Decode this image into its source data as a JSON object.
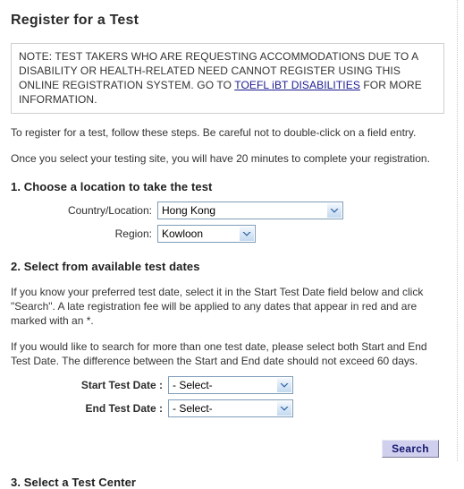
{
  "page": {
    "title": "Register for a Test"
  },
  "note": {
    "text_before_link": "NOTE: TEST TAKERS WHO ARE REQUESTING ACCOMMODATIONS DUE TO A DISABILITY OR HEALTH-RELATED NEED CANNOT REGISTER USING THIS ONLINE REGISTRATION SYSTEM. GO TO ",
    "link_label": "TOEFL iBT DISABILITIES",
    "text_after_link": " FOR MORE INFORMATION.",
    "link_color": "#1b1b8f",
    "border_color": "#cfcfcf"
  },
  "intro": {
    "paragraph_1": "To register for a test, follow these steps. Be careful not to double-click on a field entry.",
    "paragraph_2": "Once you select your testing site, you will have 20 minutes to complete your registration."
  },
  "step1": {
    "heading": "1. Choose a location to take the test",
    "country": {
      "label": "Country/Location:",
      "value": "Hong Kong",
      "arrow_icon": "chevron-down-icon"
    },
    "region": {
      "label": "Region:",
      "value": "Kowloon",
      "arrow_icon": "chevron-down-icon"
    }
  },
  "step2": {
    "heading": "2. Select from available test dates",
    "paragraph_1": "If you know your preferred test date, select it in the Start Test Date field below and click \"Search\". A late registration fee will be applied to any dates that appear in red and are marked with an *.",
    "paragraph_2": "If you would like to search for more than one test date, please select both Start and End Test Date. The difference between the Start and End date should not exceed 60 days.",
    "start_date": {
      "label": "Start Test Date :",
      "value": "- Select-",
      "arrow_icon": "chevron-down-icon"
    },
    "end_date": {
      "label": "End Test Date :",
      "value": "- Select-",
      "arrow_icon": "chevron-down-icon"
    },
    "search_button": {
      "label": "Search",
      "background_color": "#d0d0ee",
      "text_color": "#151570"
    }
  },
  "step3": {
    "heading": "3. Select a Test Center"
  }
}
